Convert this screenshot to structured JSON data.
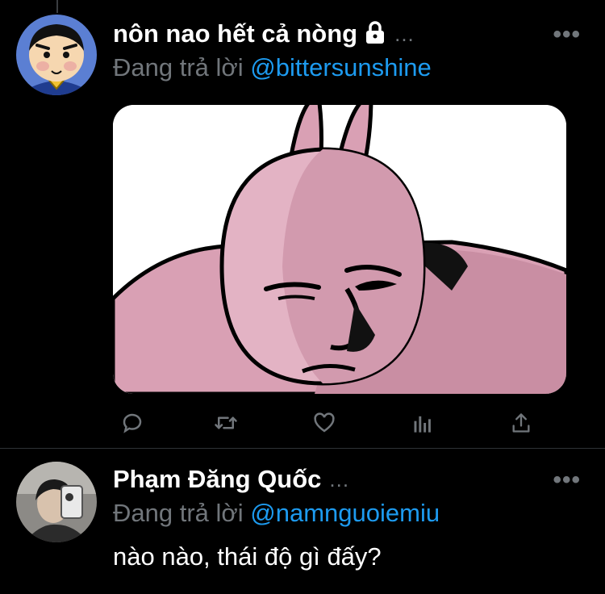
{
  "tweets": [
    {
      "author": "nôn nao hết cả nòng",
      "reply_prefix": "Đang trả lời",
      "reply_handle": "@bittersunshine",
      "name_ellipsis": "...",
      "more": "•••"
    },
    {
      "author": "Phạm Đăng Quốc",
      "reply_prefix": "Đang trả lời",
      "reply_handle": "@namnguoiemiu",
      "name_ellipsis": "...",
      "more": "•••",
      "text": "nào nào, thái độ gì đấy?"
    }
  ],
  "icons": [
    "lock-icon",
    "reply-icon",
    "retweet-icon",
    "like-icon",
    "analytics-icon",
    "share-icon",
    "more-icon"
  ],
  "colors": {
    "background": "#000000",
    "muted": "#71767b",
    "link": "#1d9bf0",
    "meme_pink": "#d9a0b4"
  }
}
